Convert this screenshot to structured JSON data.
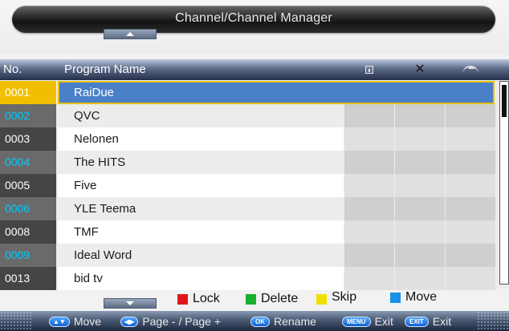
{
  "title": "Channel/Channel Manager",
  "columns": {
    "no": "No.",
    "name": "Program Name"
  },
  "column_icons": [
    "lock-icon",
    "delete-icon",
    "skip-icon"
  ],
  "channels": [
    {
      "no": "0001",
      "name": "RaiDue",
      "selected": true
    },
    {
      "no": "0002",
      "name": "QVC"
    },
    {
      "no": "0003",
      "name": "Nelonen"
    },
    {
      "no": "0004",
      "name": "The HITS"
    },
    {
      "no": "0005",
      "name": "Five"
    },
    {
      "no": "0006",
      "name": "YLE Teema"
    },
    {
      "no": "0008",
      "name": "TMF"
    },
    {
      "no": "0009",
      "name": "Ideal Word"
    },
    {
      "no": "0013",
      "name": "bid tv"
    }
  ],
  "legend": {
    "lock": {
      "label": "Lock",
      "color": "#e01818"
    },
    "delete": {
      "label": "Delete",
      "color": "#18b030"
    },
    "skip": {
      "label": "Skip",
      "color": "#f0e000"
    },
    "move": {
      "label": "Move",
      "color": "#1890e8"
    }
  },
  "hints": {
    "move_key": "▲▼",
    "move": "Move",
    "page_key": "◀▶",
    "page": "Page - / Page +",
    "ok_key": "OK",
    "rename": "Rename",
    "menu_key": "MENU",
    "menu_exit": "Exit",
    "exit_key": "EXIT",
    "exit": "Exit"
  }
}
